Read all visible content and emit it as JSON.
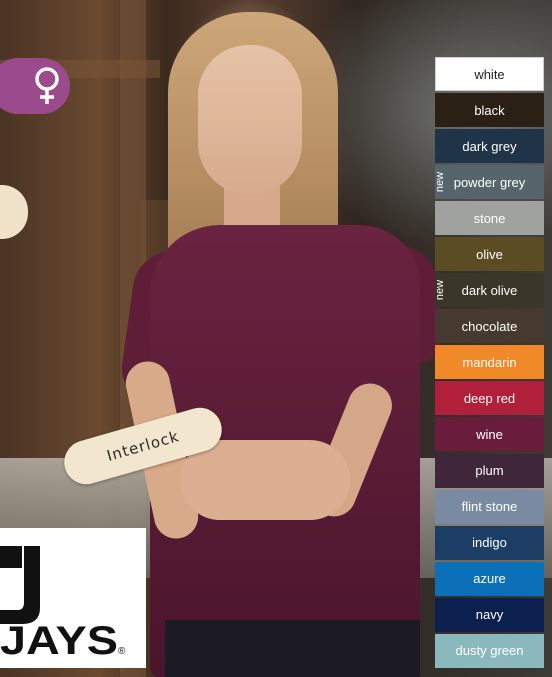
{
  "badge": {
    "symbol": "♀"
  },
  "tag": {
    "label": "Interlock"
  },
  "logo": {
    "brand_text": "JAYS",
    "registered_mark": "®"
  },
  "swatches": [
    {
      "label": "white",
      "color": "#ffffff",
      "new": false
    },
    {
      "label": "black",
      "color": "#2a2016",
      "new": false
    },
    {
      "label": "dark grey",
      "color": "#1f3448",
      "new": false
    },
    {
      "label": "powder grey",
      "color": "#56656c",
      "new": true,
      "new_label": "new"
    },
    {
      "label": "stone",
      "color": "#a0a2a0",
      "new": false
    },
    {
      "label": "olive",
      "color": "#5c4c24",
      "new": false
    },
    {
      "label": "dark olive",
      "color": "#3a3628",
      "new": true,
      "new_label": "new"
    },
    {
      "label": "chocolate",
      "color": "#463a30",
      "new": false
    },
    {
      "label": "mandarin",
      "color": "#f08a28",
      "new": false
    },
    {
      "label": "deep red",
      "color": "#b0203a",
      "new": false
    },
    {
      "label": "wine",
      "color": "#6a1c3c",
      "new": false
    },
    {
      "label": "plum",
      "color": "#40263a",
      "new": false
    },
    {
      "label": "flint stone",
      "color": "#7a8aa2",
      "new": false
    },
    {
      "label": "indigo",
      "color": "#1c3e64",
      "new": false
    },
    {
      "label": "azure",
      "color": "#0c70b8",
      "new": false
    },
    {
      "label": "navy",
      "color": "#0c2050",
      "new": false
    },
    {
      "label": "dusty green",
      "color": "#8ab8bc",
      "new": false
    }
  ]
}
